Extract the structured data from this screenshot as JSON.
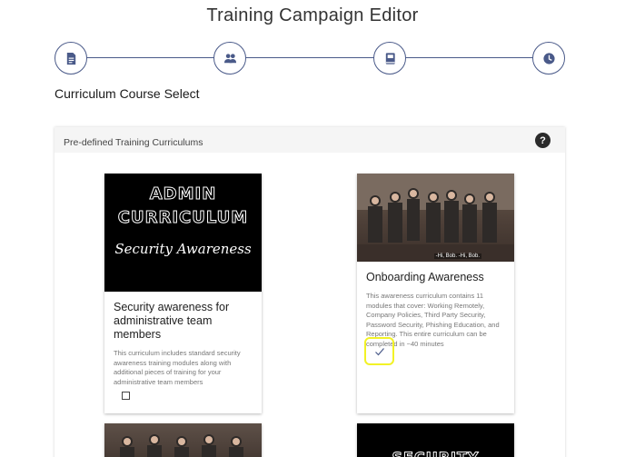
{
  "page": {
    "title": "Training Campaign Editor"
  },
  "stepper": {
    "steps": [
      {
        "name": "details",
        "icon": "document-icon",
        "active": true
      },
      {
        "name": "recipients",
        "icon": "users-icon",
        "active": true
      },
      {
        "name": "curriculum",
        "icon": "book-icon",
        "active": true
      },
      {
        "name": "schedule",
        "icon": "clock-icon",
        "active": true
      }
    ],
    "color": "#4a5a89"
  },
  "section": {
    "title": "Curriculum Course Select"
  },
  "panel": {
    "header_label": "Pre-defined Training Curriculums",
    "help_label": "?"
  },
  "cards": {
    "admin": {
      "image_text_line1": "ADMIN",
      "image_text_line2": "CURRICULUM",
      "image_text_script": "Security Awareness",
      "title": "Security awareness for administrative team members",
      "description": "This curriculum includes standard security awareness training modules along with additional pieces of training for your administrative team members",
      "selected": false
    },
    "onboarding": {
      "image_caption": "-Hi, Bob. -Hi, Bob.",
      "title": "Onboarding Awareness",
      "description": "This awareness curriculum contains 11 modules that cover: Working Remotely, Company Policies, Third Party Security, Password Security, Phishing Education, and Reporting. This entire curriculum can be completed in ~40 minutes",
      "selected": true
    },
    "bottom_right": {
      "image_text": "SECURITY"
    }
  },
  "colors": {
    "highlight": "#f2f226",
    "check": "#4a5a89"
  }
}
